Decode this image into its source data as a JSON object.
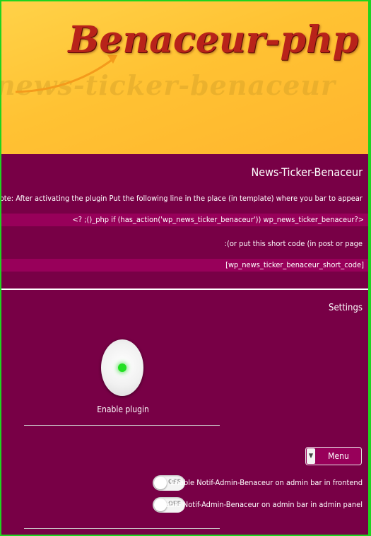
{
  "banner": {
    "logo_text": "Benaceur-php",
    "watermark_text": "news-ticker-benaceur"
  },
  "plugin": {
    "title": "News-Ticker-Benaceur",
    "note": ":Note: After activating the plugin Put the following line in the place (in template) where you bar to appear",
    "code_line": "<? ;()_php if (has_action('wp_news_ticker_benaceur')) wp_news_ticker_benaceur?>",
    "or_line": ":(or put this short code (in post or page",
    "short_code": "[wp_news_ticker_benaceur_short_code]"
  },
  "settings": {
    "title": "Settings",
    "enable_label": "Enable plugin",
    "enable_state": "on",
    "menu_label": "Menu",
    "menu_icon": "chevron-down-icon",
    "toggles": [
      {
        "label": "Enable Notif-Admin-Benaceur on admin bar in frontend",
        "state": "OFF"
      },
      {
        "label": "Enable Notif-Admin-Benaceur on admin bar in admin panel",
        "state": "OFF"
      }
    ]
  },
  "colors": {
    "background": "#780046",
    "code_band": "#98005a",
    "border": "#1fd41f",
    "banner": "#ffc233",
    "indicator": "#22e022"
  }
}
